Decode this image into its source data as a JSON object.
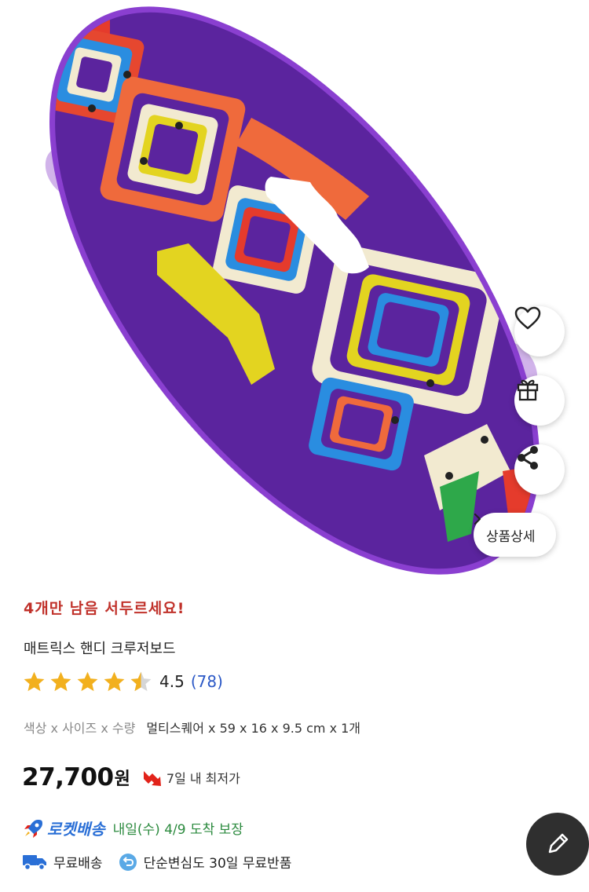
{
  "hero": {
    "image_icon": "purple-cruiser-skateboard-image",
    "like_icon": "heart-icon",
    "gift_icon": "gift-icon",
    "share_icon": "share-icon",
    "detail_button_label": "상품상세"
  },
  "product": {
    "headline": "4개만 남음 서두르세요!",
    "title": "매트릭스 핸디 크루저보드",
    "rating": "4.5",
    "rating_count": "(78)",
    "option_label": "색상 x 사이즈 x 수량",
    "option_value": "멀티스퀘어 x 59 x 16 x 9.5 cm x 1개",
    "price": "27,700",
    "price_unit": "원",
    "lowest_price_note": "7일 내 최저가",
    "rocket_label": "로켓배송",
    "delivery_date": "내일(수) 4/9 도착 보장",
    "free_shipping": "무료배송",
    "free_return": "단순변심도 30일 무료반품"
  },
  "colors": {
    "headline": "#c0312a",
    "rating_count": "#2b58c6",
    "rocket": "#2a6fd6",
    "delivery_date": "#2b8a3e",
    "star": "#f2b01e",
    "board_purple": "#6a2bb3"
  },
  "cafe_fab_icon": "cafe-write-icon"
}
